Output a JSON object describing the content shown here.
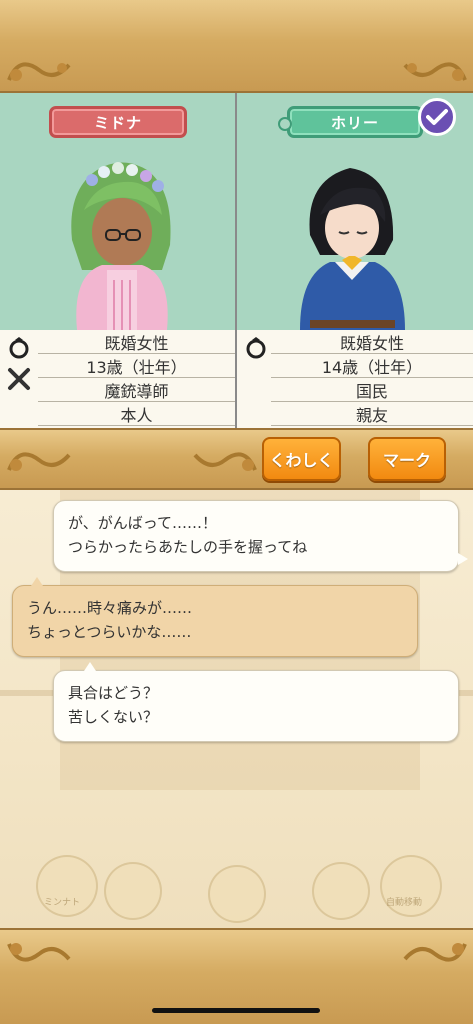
{
  "characters": {
    "left": {
      "name": "ミドナ",
      "info": [
        "既婚女性",
        "13歳（壮年）",
        "魔銃導師",
        "本人"
      ],
      "icons": [
        "ring-icon",
        "crossed-guns-icon"
      ]
    },
    "right": {
      "name": "ホリー",
      "info": [
        "既婚女性",
        "14歳（壮年）",
        "国民",
        "親友"
      ],
      "icons": [
        "ring-icon"
      ]
    }
  },
  "buttons": {
    "detail": "くわしく",
    "mark": "マーク"
  },
  "dialog": [
    {
      "speaker": "right",
      "lines": [
        "が、がんばって……！",
        "つらかったらあたしの手を握ってね"
      ]
    },
    {
      "speaker": "left",
      "lines": [
        "うん……時々痛みが……",
        "ちょっとつらいかな……"
      ]
    },
    {
      "speaker": "right",
      "lines": [
        "具合はどう？",
        "苦しくない？"
      ]
    }
  ],
  "background_menu": {
    "labels": [
      "ミンナト",
      "自動移動"
    ]
  },
  "colors": {
    "panel_bg": "#a9d6c1",
    "name_red": "#db6b6b",
    "name_green": "#5fc39b",
    "button_orange": "#f28a10",
    "check_purple": "#6b4fb3"
  }
}
